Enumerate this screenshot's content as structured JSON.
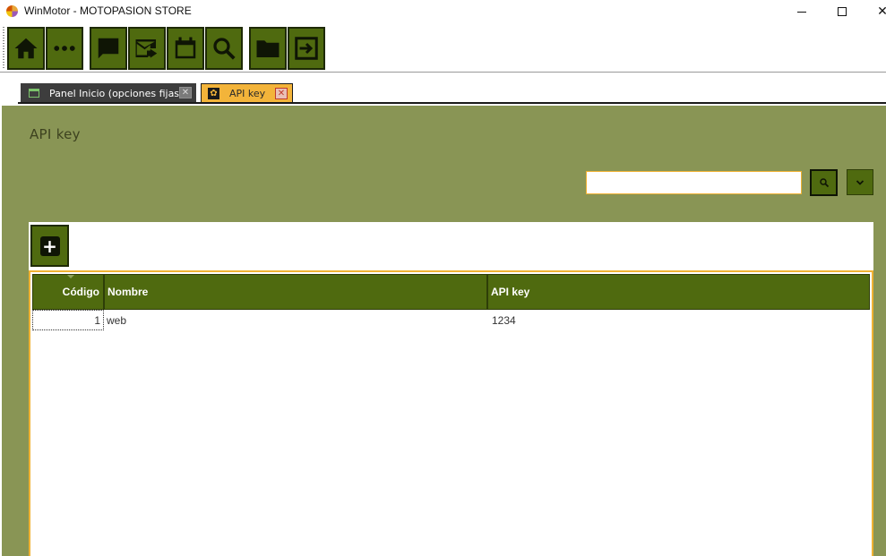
{
  "window": {
    "title": "WinMotor - MOTOPASION STORE"
  },
  "toolbar": {
    "buttons": [
      {
        "icon": "home-icon"
      },
      {
        "icon": "more-icon"
      },
      {
        "icon": "chat-icon"
      },
      {
        "icon": "mail-forward-icon"
      },
      {
        "icon": "calendar-icon"
      },
      {
        "icon": "search-icon"
      },
      {
        "icon": "folder-icon"
      },
      {
        "icon": "exit-icon"
      }
    ]
  },
  "tabs": [
    {
      "label": "Panel Inicio (opciones fijas)",
      "active": false
    },
    {
      "label": "API key",
      "active": true
    }
  ],
  "page": {
    "title": "API key",
    "search": {
      "value": "",
      "placeholder": ""
    }
  },
  "table": {
    "columns": [
      "Código",
      "Nombre",
      "API key"
    ],
    "rows": [
      {
        "codigo": "1",
        "nombre": "web",
        "api_key": "1234"
      }
    ]
  },
  "colors": {
    "accent_green": "#4f6a0f",
    "content_bg": "#899555",
    "highlight_orange": "#f3b43a"
  }
}
